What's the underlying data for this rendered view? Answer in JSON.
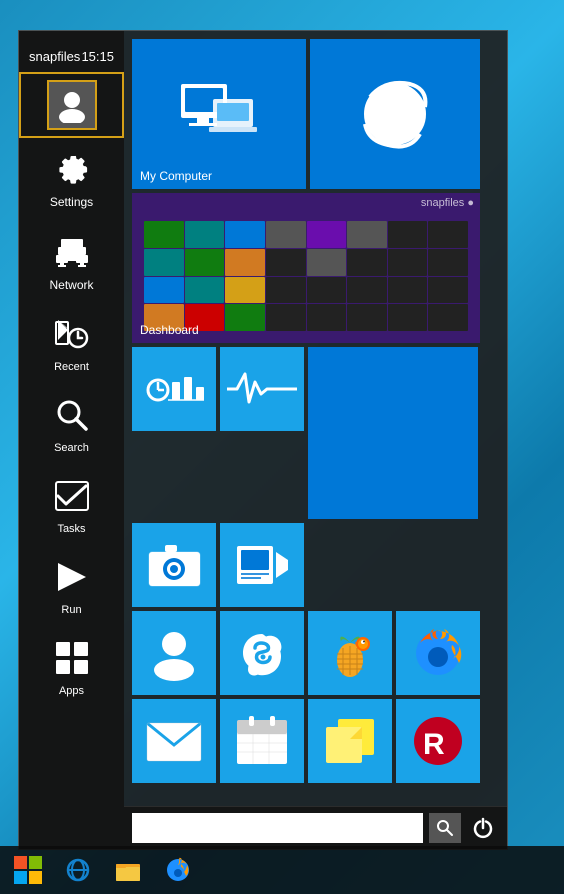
{
  "app": {
    "username": "snapfiles",
    "time": "15:15"
  },
  "sidebar": {
    "items": [
      {
        "id": "user",
        "label": "",
        "icon": "user-icon"
      },
      {
        "id": "settings",
        "label": "Settings",
        "icon": "settings-icon"
      },
      {
        "id": "network",
        "label": "Network",
        "icon": "network-icon"
      },
      {
        "id": "recent",
        "label": "Recent",
        "icon": "recent-icon"
      },
      {
        "id": "search",
        "label": "Search",
        "icon": "search-icon"
      },
      {
        "id": "tasks",
        "label": "Tasks",
        "icon": "tasks-icon"
      },
      {
        "id": "run",
        "label": "Run",
        "icon": "run-icon"
      },
      {
        "id": "apps",
        "label": "Apps",
        "icon": "apps-icon"
      }
    ]
  },
  "tiles": {
    "row1": [
      {
        "id": "my-computer",
        "label": "My Computer",
        "color": "#0078d7"
      },
      {
        "id": "internet-explorer",
        "label": "",
        "color": "#0078d7"
      }
    ],
    "row2": [
      {
        "id": "dashboard",
        "label": "Dashboard",
        "color": "#3a1a6e"
      }
    ],
    "row3": [
      {
        "id": "stats",
        "label": "",
        "color": "#1aa3e8"
      },
      {
        "id": "ekg",
        "label": "",
        "color": "#1aa3e8"
      },
      {
        "id": "blue-large",
        "label": "",
        "color": "#0078d7"
      }
    ],
    "row4": [
      {
        "id": "camera",
        "label": "",
        "color": "#1aa3e8"
      },
      {
        "id": "video",
        "label": "",
        "color": "#1aa3e8"
      }
    ],
    "row5": [
      {
        "id": "contact",
        "label": "",
        "color": "#1aa3e8"
      },
      {
        "id": "skype",
        "label": "",
        "color": "#1aa3e8"
      },
      {
        "id": "fruity",
        "label": "",
        "color": "#1aa3e8"
      },
      {
        "id": "firefox",
        "label": "",
        "color": "#1aa3e8"
      }
    ],
    "row6": [
      {
        "id": "mail",
        "label": "",
        "color": "#1aa3e8"
      },
      {
        "id": "calendar",
        "label": "",
        "color": "#1aa3e8"
      },
      {
        "id": "stickynotes",
        "label": "",
        "color": "#1aa3e8"
      },
      {
        "id": "red-app",
        "label": "",
        "color": "#1aa3e8"
      }
    ]
  },
  "bottom_bar": {
    "search_placeholder": "",
    "search_btn_label": "🔍",
    "power_btn_label": "⏻"
  },
  "taskbar": {
    "items": [
      {
        "id": "start",
        "label": "Start"
      },
      {
        "id": "ie",
        "label": "Internet Explorer"
      },
      {
        "id": "explorer",
        "label": "File Explorer"
      },
      {
        "id": "firefox",
        "label": "Firefox"
      }
    ]
  }
}
